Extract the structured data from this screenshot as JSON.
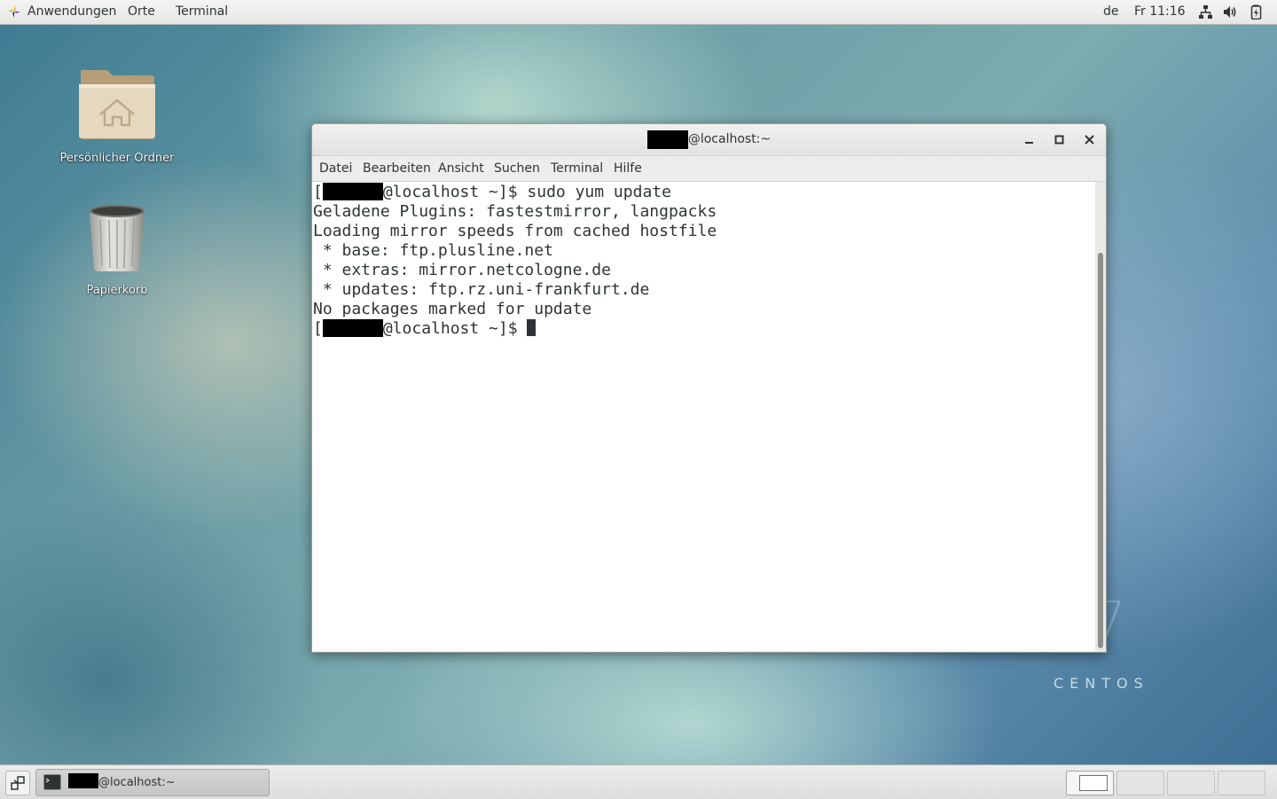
{
  "top_bar": {
    "menus": [
      "Anwendungen",
      "Orte",
      "Terminal"
    ],
    "keyboard_layout": "de",
    "clock": "Fr 11:16",
    "tray_icons": [
      "network-icon",
      "volume-icon",
      "battery-icon"
    ]
  },
  "desktop": {
    "icons": [
      {
        "label": "Persönlicher Ordner",
        "icon": "home-folder-icon"
      },
      {
        "label": "Papierkorb",
        "icon": "trash-icon"
      }
    ],
    "watermark": "CENTOS",
    "watermark_digit": "7"
  },
  "terminal_window": {
    "title": "@localhost:~",
    "menu": [
      "Datei",
      "Bearbeiten",
      "Ansicht",
      "Suchen",
      "Terminal",
      "Hilfe"
    ],
    "lines": [
      {
        "prefix": "[",
        "redacted": true,
        "text": "@localhost ~]$ sudo yum update"
      },
      {
        "prefix": "",
        "redacted": false,
        "text": "Geladene Plugins: fastestmirror, langpacks"
      },
      {
        "prefix": "",
        "redacted": false,
        "text": "Loading mirror speeds from cached hostfile"
      },
      {
        "prefix": "",
        "redacted": false,
        "text": " * base: ftp.plusline.net"
      },
      {
        "prefix": "",
        "redacted": false,
        "text": " * extras: mirror.netcologne.de"
      },
      {
        "prefix": "",
        "redacted": false,
        "text": " * updates: ftp.rz.uni-frankfurt.de"
      },
      {
        "prefix": "",
        "redacted": false,
        "text": "No packages marked for update"
      },
      {
        "prefix": "[",
        "redacted": true,
        "text": "@localhost ~]$ "
      }
    ],
    "buttons": [
      "minimize-button",
      "maximize-button",
      "close-button"
    ]
  },
  "bottom_bar": {
    "task": {
      "label": "@localhost:~",
      "icon": "terminal-icon"
    },
    "workspaces": 4,
    "active_workspace": 1
  }
}
